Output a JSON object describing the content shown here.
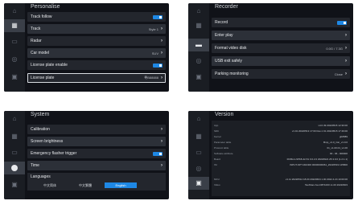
{
  "personalise": {
    "title": "Personalise",
    "track_follow": {
      "label": "Track follow"
    },
    "track": {
      "label": "Track",
      "value": "Style 1"
    },
    "radar": {
      "label": "Radar"
    },
    "car_model": {
      "label": "Car model",
      "value": "SUV"
    },
    "license_plate_enable": {
      "label": "License plate enable"
    },
    "license_plate": {
      "label": "License plate",
      "value": "粤B88888"
    }
  },
  "recorder": {
    "title": "Recorder",
    "record": {
      "label": "Record"
    },
    "enter_play": {
      "label": "Enter play"
    },
    "format_disk": {
      "label": "Format video disk",
      "value": "0.0G / 7.3G"
    },
    "usb_exit": {
      "label": "USB exit safely"
    },
    "parking": {
      "label": "Parking monitoring",
      "value": "Close"
    }
  },
  "system": {
    "title": "System",
    "calibration": {
      "label": "Calibration"
    },
    "brightness": {
      "label": "Screen brightness"
    },
    "emergency": {
      "label": "Emergency flasher trigger"
    },
    "time": {
      "label": "Time"
    },
    "languages": {
      "label": "Languages",
      "options": [
        "中文简体",
        "中文繁體",
        "English"
      ],
      "selected": "English"
    }
  },
  "version": {
    "title": "Version",
    "rows": [
      {
        "k": "App",
        "v": "v4.0.49 20220515 12:30:00"
      },
      {
        "k": "SDK",
        "v": "v1.01 20220513 17:00 Rev.1 01 20220515 17:46:00"
      },
      {
        "k": "Kernel",
        "v": "gb6589"
      },
      {
        "k": "Parameter table",
        "v": "Bmp_v1.0_Car_v1.0.0"
      },
      {
        "k": "Protocol table",
        "v": "01_v1.00.01_v1.00"
      },
      {
        "k": "Software attribute",
        "v": "00 - 06 - 000000"
      },
      {
        "k": "Board",
        "v": "RCBLA-NPK8-42-51 0.0.2.0 20220921 25.3.0.0 (1.2.1.1)"
      },
      {
        "k": "ISI",
        "v": "INPUT-NPT-002400 00000000061_20220519 125800"
      },
      {
        "k": "",
        "v": ""
      },
      {
        "k": "MCU",
        "v": "v1.11 20220512 18:20 20220604 1.00 2022.4.24 10:00:00"
      },
      {
        "k": "Video",
        "v": "TaoShan-hsv-D871000 v1.00 20220603"
      }
    ]
  },
  "colors": {
    "accent": "#1e88e5",
    "background": "#101218"
  },
  "icons": [
    "home-icon",
    "display-icon",
    "camera-icon",
    "settings-icon",
    "info-icon"
  ]
}
